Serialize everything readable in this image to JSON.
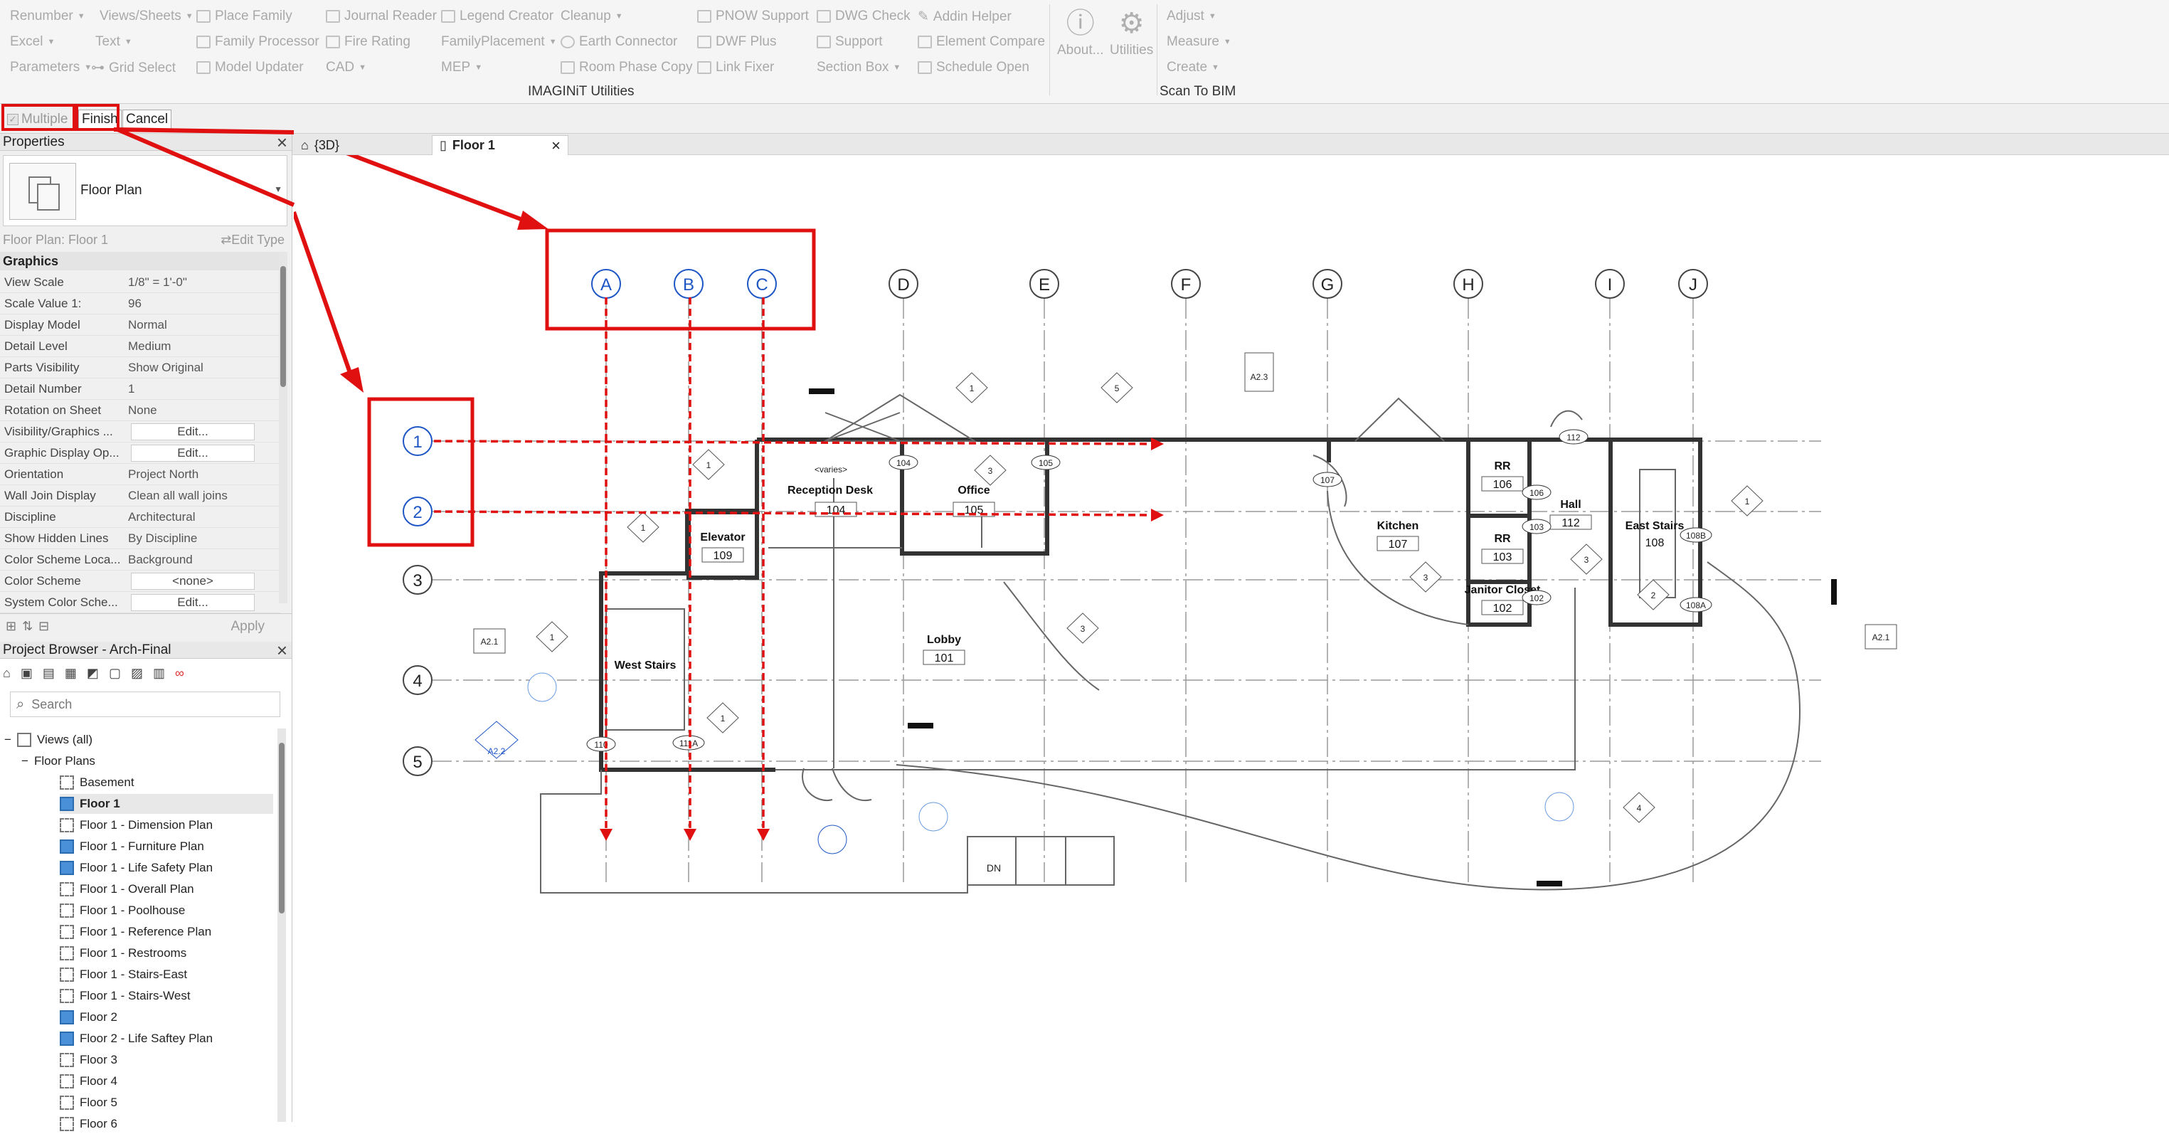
{
  "ribbon": {
    "col1": [
      "Renumber",
      "Excel",
      "Parameters"
    ],
    "col2": [
      "Views/Sheets",
      "Text",
      "Grid Select"
    ],
    "col3": [
      "Place Family",
      "Family Processor",
      "Model Updater"
    ],
    "col4": [
      "Journal Reader",
      "Fire Rating",
      "CAD"
    ],
    "col5": [
      "Legend Creator",
      "FamilyPlacement",
      "MEP"
    ],
    "col6": [
      "Cleanup",
      "Earth Connector",
      "Room Phase Copy"
    ],
    "col7": [
      "PNOW Support",
      "DWF Plus",
      "Link Fixer"
    ],
    "col8": [
      "DWG Check",
      "Support",
      "Section Box"
    ],
    "col9": [
      "Addin Helper",
      "Element Compare",
      "Schedule Open"
    ],
    "about": "About...",
    "utilities": "Utilities",
    "scan": [
      "Adjust",
      "Measure",
      "Create"
    ],
    "panel_label": "IMAGINiT Utilities",
    "scan_label": "Scan To BIM"
  },
  "options": {
    "multiple": "Multiple",
    "finish": "Finish",
    "cancel": "Cancel"
  },
  "properties": {
    "title": "Properties",
    "type_name": "Floor Plan",
    "instance": "Floor Plan: Floor 1",
    "edit_type": "Edit Type",
    "section": "Graphics",
    "rows": [
      {
        "k": "View Scale",
        "v": "1/8\" = 1'-0\""
      },
      {
        "k": "Scale Value    1:",
        "v": "96"
      },
      {
        "k": "Display Model",
        "v": "Normal"
      },
      {
        "k": "Detail Level",
        "v": "Medium"
      },
      {
        "k": "Parts Visibility",
        "v": "Show Original"
      },
      {
        "k": "Detail Number",
        "v": "1"
      },
      {
        "k": "Rotation on Sheet",
        "v": "None"
      },
      {
        "k": "Visibility/Graphics ...",
        "v": "Edit..."
      },
      {
        "k": "Graphic Display Op...",
        "v": "Edit..."
      },
      {
        "k": "Orientation",
        "v": "Project North"
      },
      {
        "k": "Wall Join Display",
        "v": "Clean all wall joins"
      },
      {
        "k": "Discipline",
        "v": "Architectural"
      },
      {
        "k": "Show Hidden Lines",
        "v": "By Discipline"
      },
      {
        "k": "Color Scheme Loca...",
        "v": "Background"
      },
      {
        "k": "Color Scheme",
        "v": "<none>"
      },
      {
        "k": "System Color Sche...",
        "v": "Edit..."
      }
    ],
    "apply": "Apply"
  },
  "browser": {
    "title": "Project Browser - Arch-Final",
    "search_placeholder": "Search",
    "root": "Views (all)",
    "group": "Floor Plans",
    "items": [
      "Basement",
      "Floor 1",
      "Floor 1 - Dimension Plan",
      "Floor 1 - Furniture Plan",
      "Floor 1 - Life Safety Plan",
      "Floor 1 - Overall Plan",
      "Floor 1 - Poolhouse",
      "Floor 1 - Reference Plan",
      "Floor 1 - Restrooms",
      "Floor 1 - Stairs-East",
      "Floor 1 - Stairs-West",
      "Floor 2",
      "Floor 2 - Life Saftey Plan",
      "Floor 3",
      "Floor 4",
      "Floor 5",
      "Floor 6"
    ]
  },
  "tabs": {
    "t1": "{3D}",
    "t2": "Floor 1"
  },
  "plan": {
    "grids_x": [
      "A",
      "B",
      "C",
      "D",
      "E",
      "F",
      "G",
      "H",
      "I",
      "J"
    ],
    "grids_y": [
      "1",
      "2",
      "3",
      "4",
      "5"
    ],
    "rooms": [
      {
        "name": "Reception Desk",
        "num": "104"
      },
      {
        "name": "Office",
        "num": "105"
      },
      {
        "name": "Elevator",
        "num": "109"
      },
      {
        "name": "Lobby",
        "num": "101"
      },
      {
        "name": "West Stairs",
        "num": ""
      },
      {
        "name": "Kitchen",
        "num": "107"
      },
      {
        "name": "RR",
        "num": "106"
      },
      {
        "name": "RR",
        "num": "103"
      },
      {
        "name": "Janitor Closet",
        "num": "102"
      },
      {
        "name": "Hall",
        "num": "112"
      },
      {
        "name": "East Stairs",
        "num": "108"
      }
    ],
    "tags": {
      "a23": "A2.3",
      "a21": "A2.1",
      "a22": "A2.2",
      "a21r": "A2.1",
      "dn": "DN",
      "varies": "<varies>",
      "d104": "104",
      "d105": "105",
      "d107": "107",
      "d112": "112",
      "d106": "106",
      "d103": "103",
      "d102": "102",
      "d108b": "108B",
      "d108a": "108A",
      "d110": "110",
      "d111a": "111A",
      "n1": "1",
      "n2": "2",
      "n3": "3",
      "n4": "4",
      "n5": "5"
    }
  },
  "colors": {
    "highlight": "#e01010",
    "grid_blue": "#1f56c5"
  }
}
